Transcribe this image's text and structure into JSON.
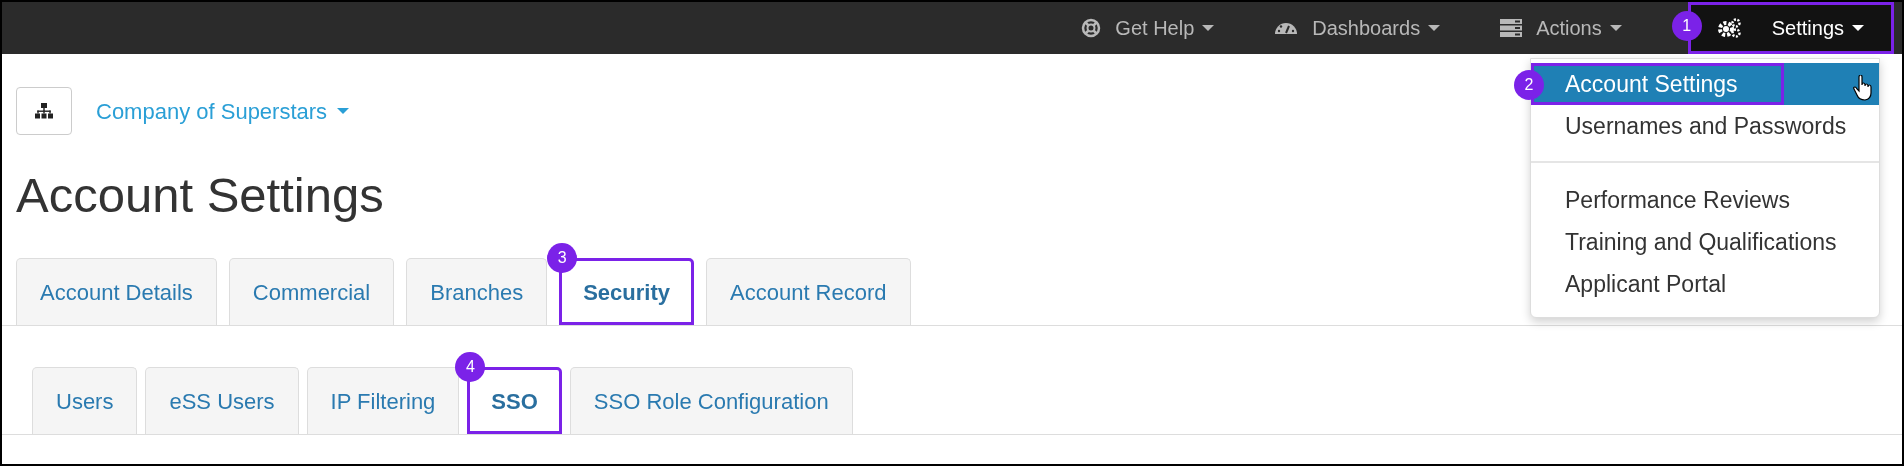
{
  "navbar": {
    "items": [
      {
        "label": "Get Help",
        "selected": false
      },
      {
        "label": "Dashboards",
        "selected": false
      },
      {
        "label": "Actions",
        "selected": false
      },
      {
        "label": "Settings",
        "selected": true,
        "callout": "1"
      }
    ]
  },
  "dropdown": {
    "items": [
      {
        "kind": "item",
        "label": "Account Settings",
        "selected": true,
        "callout": "2"
      },
      {
        "kind": "item",
        "label": "Usernames and Passwords",
        "selected": false
      },
      {
        "kind": "divider"
      },
      {
        "kind": "item",
        "label": "Performance Reviews",
        "selected": false
      },
      {
        "kind": "item",
        "label": "Training and Qualifications",
        "selected": false
      },
      {
        "kind": "item",
        "label": "Applicant Portal",
        "selected": false
      }
    ]
  },
  "company": {
    "label": "Company of Superstars"
  },
  "title": "Account Settings",
  "tabs": [
    {
      "label": "Account Details",
      "selected": false
    },
    {
      "label": "Commercial",
      "selected": false
    },
    {
      "label": "Branches",
      "selected": false
    },
    {
      "label": "Security",
      "selected": true,
      "callout": "3"
    },
    {
      "label": "Account Record",
      "selected": false
    }
  ],
  "subtabs": [
    {
      "label": "Users",
      "selected": false
    },
    {
      "label": "eSS Users",
      "selected": false
    },
    {
      "label": "IP Filtering",
      "selected": false
    },
    {
      "label": "SSO",
      "selected": true,
      "callout": "4"
    },
    {
      "label": "SSO Role Configuration",
      "selected": false
    }
  ]
}
